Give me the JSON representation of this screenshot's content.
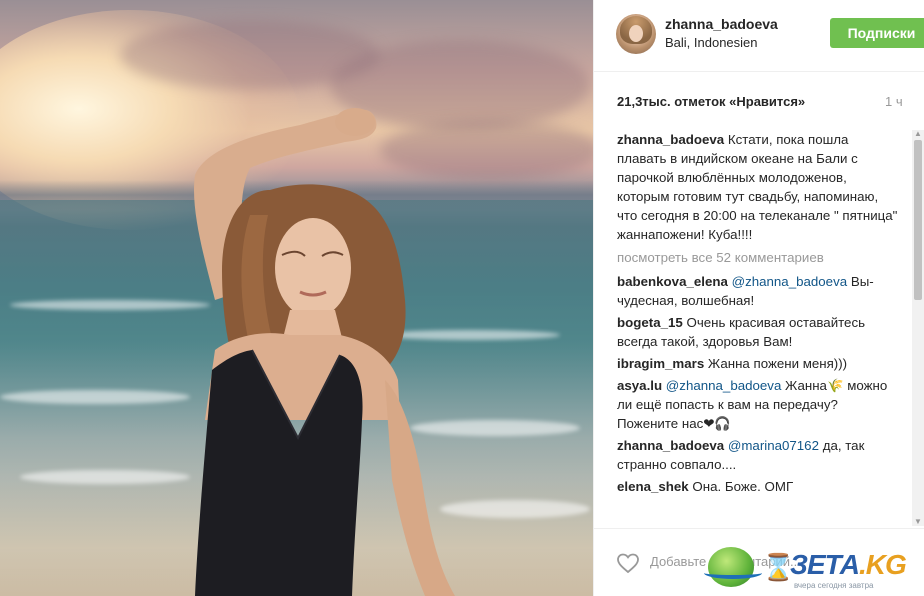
{
  "post": {
    "username": "zhanna_badoeva",
    "location": "Bali, Indonesien",
    "follow_label": "Подписки",
    "likes": "21,3тыс. отметок «Нравится»",
    "time_ago": "1 ч",
    "caption": {
      "author": "zhanna_badoeva",
      "text": "Кстати, пока пошла плавать в индийском океане на Бали с парочкой влюблённых молодоженов, которым готовим тут свадьбу, напоминаю, что сегодня в 20:00 на телеканале \" пятница\" жаннапожени! Куба!!!!"
    },
    "view_all_comments": "посмотреть все 52 комментариев",
    "comments": [
      {
        "author": "babenkova_elena",
        "mention": "@zhanna_badoeva",
        "text": "Вы-чудесная, волшебная!"
      },
      {
        "author": "bogeta_15",
        "mention": "",
        "text": "Очень красивая оставайтесь всегда такой, здоровья Вам!"
      },
      {
        "author": "ibragim_mars",
        "mention": "",
        "text": "Жанна пожени меня)))"
      },
      {
        "author": "asya.lu",
        "mention": "@zhanna_badoeva",
        "text": "Жанна🌾 можно ли ещё попасть к вам на передачу? Пожените нас❤🎧"
      },
      {
        "author": "zhanna_badoeva",
        "mention": "@marina07162",
        "text": "да, так странно совпало...."
      },
      {
        "author": "elena_shek",
        "mention": "",
        "text": "Она. Боже. ОМГ"
      }
    ],
    "add_comment_placeholder": "Добавьте комментарий..."
  },
  "watermark": {
    "brand": "ЗЕТА",
    "tld": ".KG",
    "tagline": "вчера сегодня завтра"
  },
  "icons": {
    "like": "heart-outline-icon",
    "scroll_up": "scroll-up-arrow-icon",
    "scroll_down": "scroll-down-arrow-icon"
  },
  "colors": {
    "follow_button": "#70c050",
    "mention": "#125688",
    "muted": "#999999"
  }
}
